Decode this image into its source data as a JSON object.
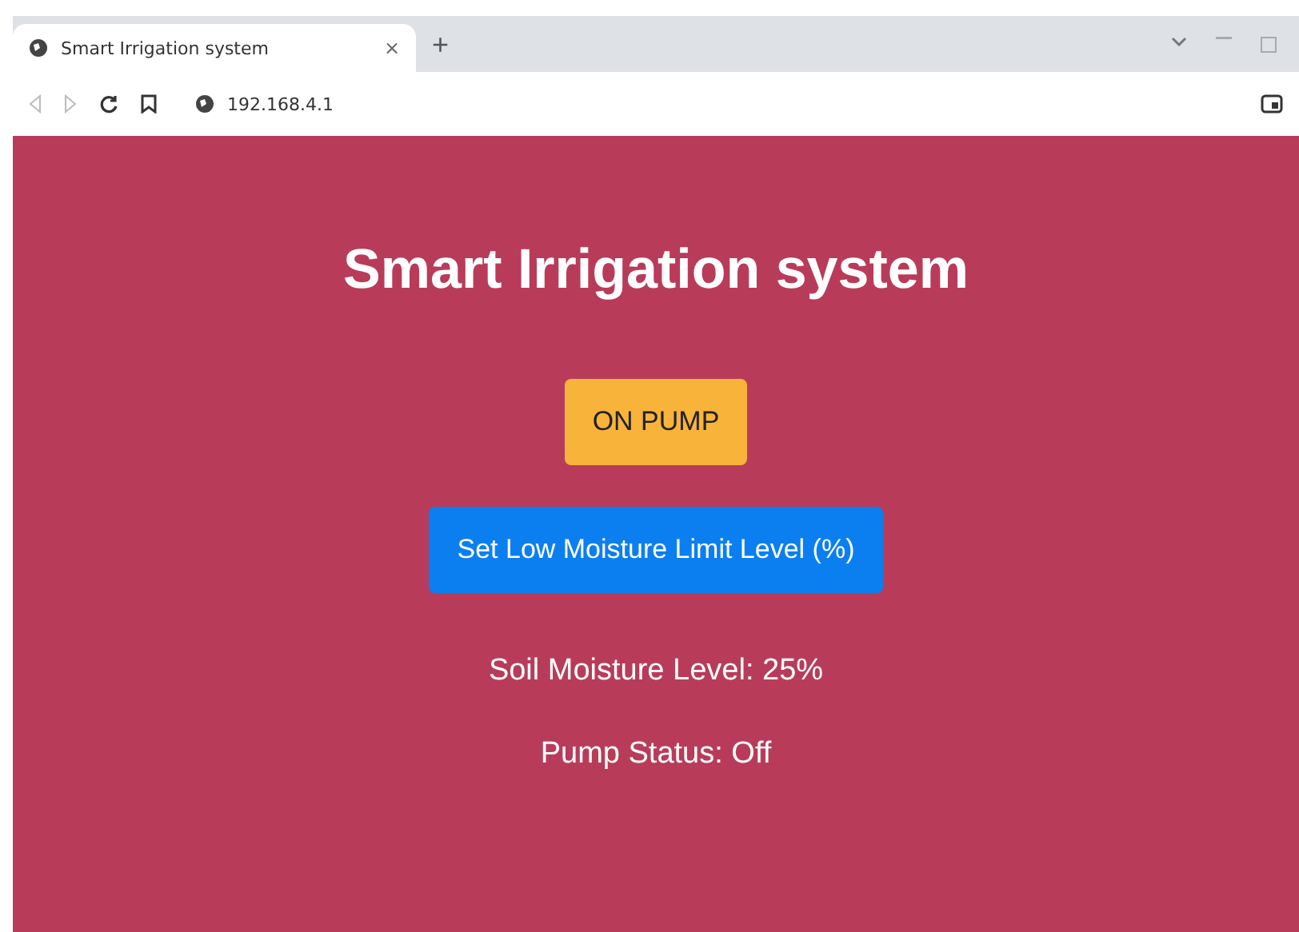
{
  "browser": {
    "tab": {
      "title": "Smart Irrigation system",
      "close": "×"
    },
    "new_tab": "+",
    "address": "192.168.4.1"
  },
  "page": {
    "title": "Smart Irrigation system",
    "buttons": [
      {
        "label": "ON PUMP",
        "kind": "warning"
      },
      {
        "label": "Set Low Moisture Limit Level (%)",
        "kind": "primary"
      }
    ],
    "readings": [
      "Soil Moisture Level: 25%",
      "Pump Status: Off"
    ]
  }
}
